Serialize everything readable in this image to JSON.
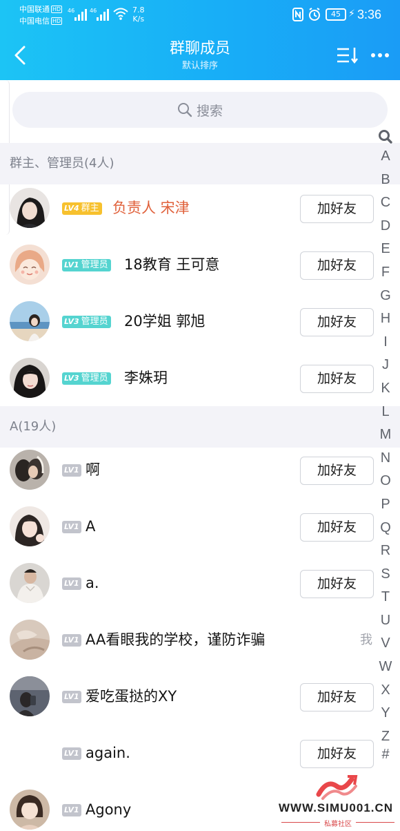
{
  "status_bar": {
    "carrier1": "中国联通",
    "carrier2": "中国电信",
    "hd": "HD",
    "signal_label": "46",
    "speed_value": "7.8",
    "speed_unit": "K/s",
    "battery": "45",
    "time": "3:36"
  },
  "header": {
    "title": "群聊成员",
    "subtitle": "默认排序"
  },
  "search": {
    "placeholder": "搜索"
  },
  "sections": [
    {
      "header": "群主、管理员(4人)",
      "members": [
        {
          "level": "LV4",
          "role": "群主",
          "name": "负责人 宋津",
          "action": "加好友"
        },
        {
          "level": "LV1",
          "role": "管理员",
          "name": "18教育 王可意",
          "action": "加好友"
        },
        {
          "level": "LV3",
          "role": "管理员",
          "name": "20学姐 郭旭",
          "action": "加好友"
        },
        {
          "level": "LV3",
          "role": "管理员",
          "name": "李姝玥",
          "action": "加好友"
        }
      ]
    },
    {
      "header": "A(19人)",
      "members": [
        {
          "level": "LV1",
          "name": "啊",
          "action": "加好友"
        },
        {
          "level": "LV1",
          "name": "A",
          "action": "加好友"
        },
        {
          "level": "LV1",
          "name": "a.",
          "action": "加好友"
        },
        {
          "level": "LV1",
          "name": "AA看眼我的学校，谨防诈骗",
          "self_label": "我"
        },
        {
          "level": "LV1",
          "name": "爱吃蛋挞的XY",
          "action": "加好友"
        },
        {
          "level": "LV1",
          "name": "again.",
          "action": "加好友"
        },
        {
          "level": "LV1",
          "name": "Agony"
        }
      ]
    }
  ],
  "index_letters": [
    "A",
    "B",
    "C",
    "D",
    "E",
    "F",
    "G",
    "H",
    "I",
    "J",
    "K",
    "L",
    "M",
    "N",
    "O",
    "P",
    "Q",
    "R",
    "S",
    "T",
    "U",
    "V",
    "W",
    "X",
    "Y",
    "Z",
    "#"
  ],
  "watermark": {
    "text": "WWW.SIMU001.CN",
    "sub": "私募社区"
  },
  "colors": {
    "header_gradient_start": "#1cc4f5",
    "header_gradient_end": "#1a9cf6",
    "owner_name": "#e0603a",
    "owner_tag": "#f7c12e",
    "admin_tag": "#55d4d0",
    "member_tag": "#c2c4cc",
    "section_bg": "#f3f3f8"
  }
}
